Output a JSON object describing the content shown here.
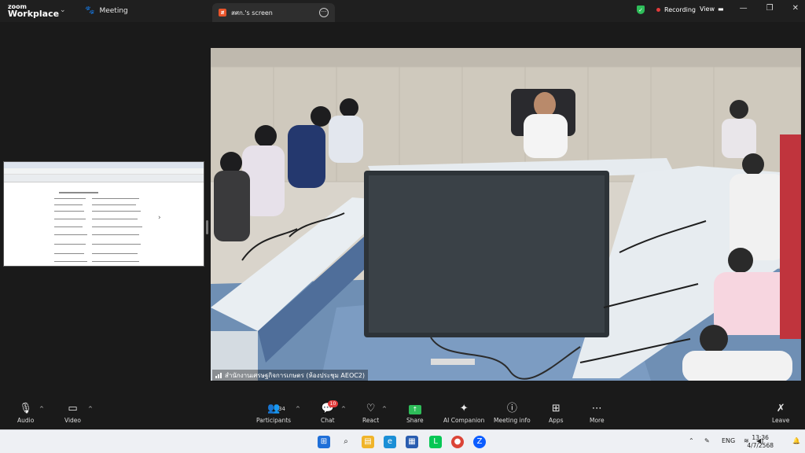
{
  "titlebar": {
    "brand_top": "zoom",
    "brand_bottom": "Workplace",
    "meeting_label": "Meeting",
    "screen_tab_label": "สศก.'s screen",
    "recording_label": "Recording",
    "view_label": "View"
  },
  "video": {
    "participant_label": "สำนักงานเศรษฐกิจการเกษตร (ห้องประชุม AEOC2)"
  },
  "toolbar": {
    "audio": "Audio",
    "video": "Video",
    "participants": "Participants",
    "participants_count": "34",
    "chat": "Chat",
    "chat_badge": "10",
    "react": "React",
    "share": "Share",
    "ai_companion": "AI Companion",
    "meeting_info": "Meeting info",
    "apps": "Apps",
    "more": "More",
    "leave": "Leave"
  },
  "taskbar": {
    "lang": "ENG",
    "time": "13:36",
    "date": "4/7/2568"
  },
  "colors": {
    "accent_green": "#2ebd59",
    "alert_red": "#e23b3b",
    "zoom_blue": "#0b5cff"
  }
}
